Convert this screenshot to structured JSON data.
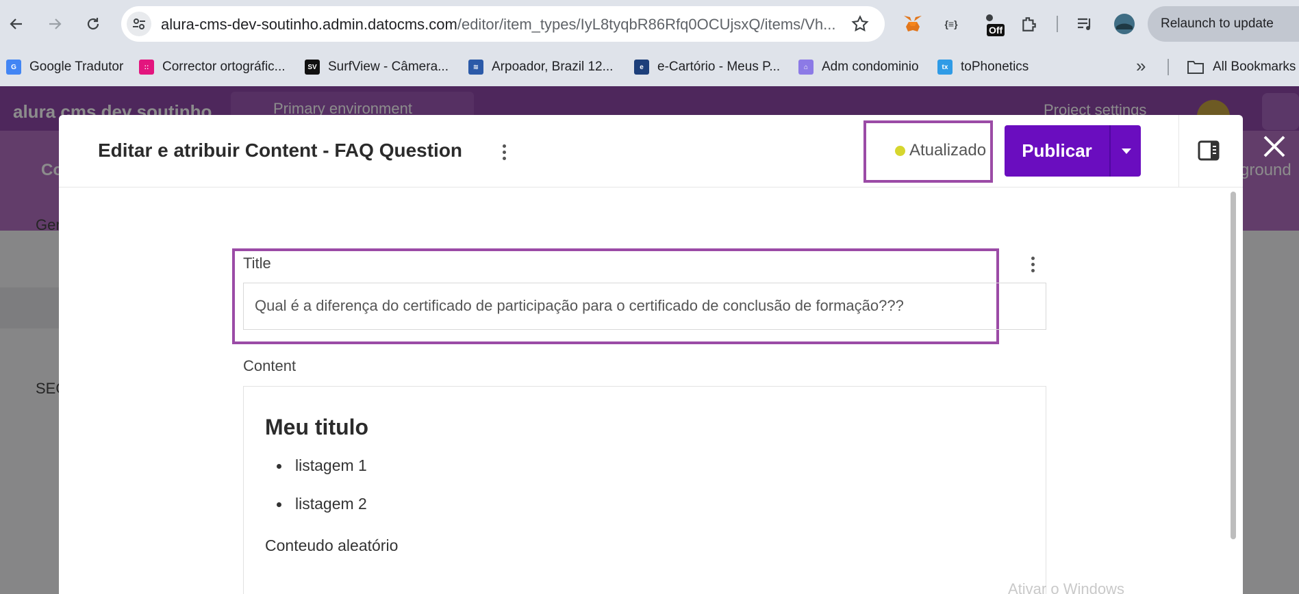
{
  "browser": {
    "url_host": "alura-cms-dev-soutinho.admin.datocms.com",
    "url_path": "/editor/item_types/IyL8tyqbR86Rfq0OCUjsxQ/items/Vh...",
    "relaunch_label": "Relaunch to update",
    "ext_off_badge": "Off",
    "ext_braces": "{≡}",
    "bookmarks": [
      {
        "label": "Google Tradutor",
        "color": "#4285f4",
        "glyph": "G"
      },
      {
        "label": "Corrector ortográfic...",
        "color": "#e3157e",
        "glyph": "::"
      },
      {
        "label": "SurfView - Câmera...",
        "color": "#111111",
        "glyph": "SV"
      },
      {
        "label": "Arpoador, Brazil 12...",
        "color": "#2b5aa8",
        "glyph": "≋"
      },
      {
        "label": "e-Cartório - Meus P...",
        "color": "#1d3f7a",
        "glyph": "e"
      },
      {
        "label": "Adm condominio",
        "color": "#8c7ae6",
        "glyph": "⌂"
      },
      {
        "label": "toPhonetics",
        "color": "#2f9be6",
        "glyph": "tx"
      }
    ],
    "all_bookmarks_label": "All Bookmarks",
    "more_label": "»"
  },
  "app": {
    "title": "alura cms dev soutinho",
    "environment": "Primary environment",
    "project_settings": "Project settings",
    "sidebar_group": "Ger",
    "sidebar_seo": "SEO",
    "sidebar_content_tab": "Co",
    "background_right": "ground"
  },
  "modal": {
    "title": "Editar e atribuir Content - FAQ Question",
    "status": "Atualizado",
    "status_color": "#d6d62e",
    "publish_label": "Publicar",
    "accent": "#6a0dbf",
    "highlight": "#9b4ba6",
    "fields": {
      "title_label": "Title",
      "title_value": "Qual é a diferença do certificado de participação para o certificado de conclusão de formação???",
      "content_label": "Content",
      "content": {
        "heading": "Meu titulo",
        "items": [
          "listagem 1",
          "listagem 2"
        ],
        "paragraph": "Conteudo aleatório"
      }
    }
  },
  "watermark": "Ativar o Windows"
}
